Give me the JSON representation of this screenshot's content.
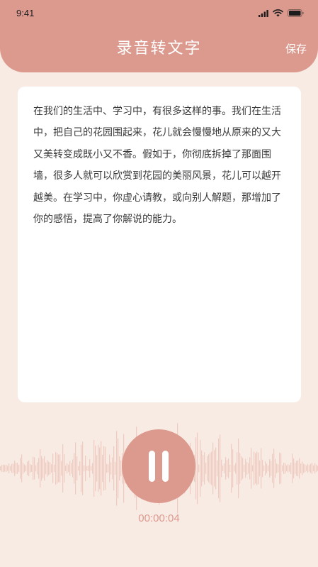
{
  "status_bar": {
    "time": "9:41",
    "icons": [
      "signal-icon",
      "wifi-icon",
      "battery-icon"
    ]
  },
  "header": {
    "title": "录音转文字",
    "save_label": "保存"
  },
  "transcript": {
    "text": "在我们的生活中、学习中，有很多这样的事。我们在生活中，把自己的花园围起来，花儿就会慢慢地从原来的又大又美转变成既小又不香。假如于，你彻底拆掉了那面围墙，很多人就可以欣赏到花园的美丽风景，花儿可以越开越美。在学习中，你虚心请教，或向别人解题，那增加了你的感悟，提高了你解说的能力。"
  },
  "recorder": {
    "state_icon": "pause-icon",
    "timer": "00:00:04"
  },
  "colors": {
    "accent": "#dc9a8f",
    "background": "#f8ebe3",
    "card": "#ffffff",
    "waveform": "#e7b3a7"
  }
}
